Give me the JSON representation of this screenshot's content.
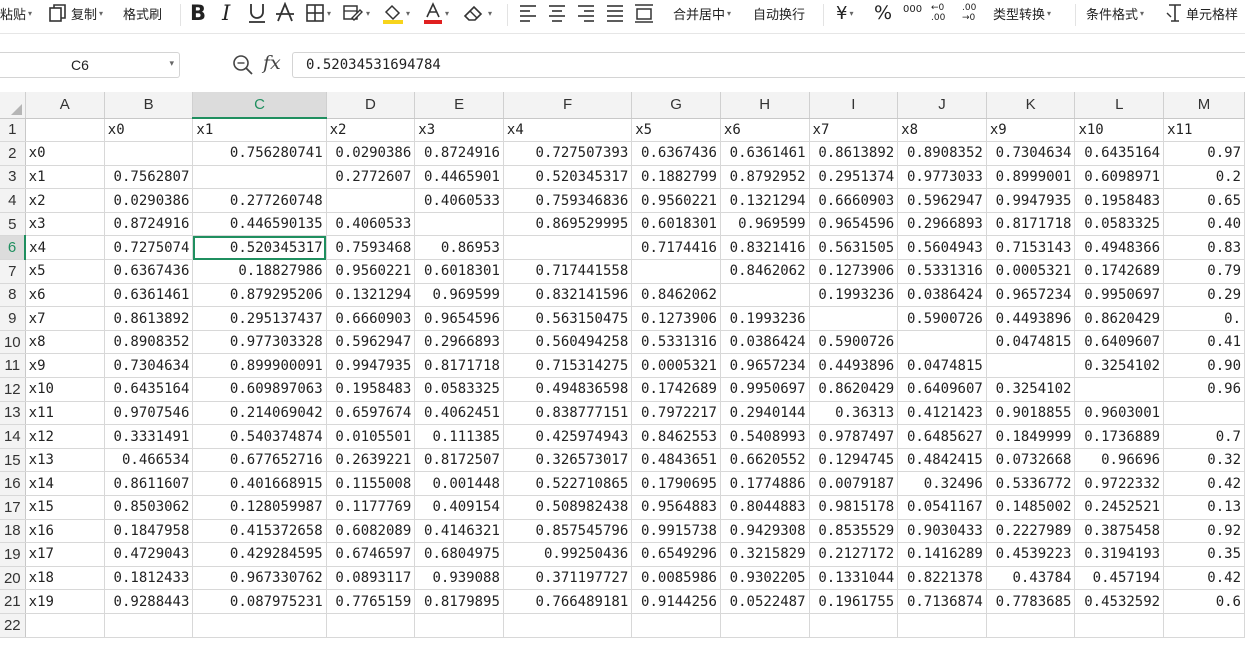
{
  "toolbar": {
    "paste": "粘贴",
    "copy": "复制",
    "format_painter": "格式刷",
    "merge_center": "合并居中",
    "wrap_text": "自动换行",
    "currency_symbol": "¥",
    "percent_symbol": "%",
    "thousands_symbol": "000",
    "increase_decimal": "←0 .00",
    "decrease_decimal": ".00 →0",
    "type_convert": "类型转换",
    "conditional_format": "条件格式",
    "cell_style": "单元格样",
    "font_color": "#e02020",
    "fill_color": "#f7d41c"
  },
  "formula_bar": {
    "name_box": "C6",
    "fx_label": "fx",
    "value": "0.52034531694784"
  },
  "grid": {
    "columns": [
      "A",
      "B",
      "C",
      "D",
      "E",
      "F",
      "G",
      "H",
      "I",
      "J",
      "K",
      "L",
      "M"
    ],
    "row_numbers": [
      "1",
      "2",
      "3",
      "4",
      "5",
      "6",
      "7",
      "8",
      "9",
      "10",
      "11",
      "12",
      "13",
      "14",
      "15",
      "16",
      "17",
      "18",
      "19",
      "20",
      "21",
      "22"
    ],
    "selected_column": "C",
    "selected_row": "6",
    "active_cell": "C6",
    "accent_color": "#1f8f5f",
    "rows": [
      [
        "",
        "x0",
        "x1",
        "x2",
        "x3",
        "x4",
        "x5",
        "x6",
        "x7",
        "x8",
        "x9",
        "x10",
        "x11"
      ],
      [
        "x0",
        "",
        "0.756280741",
        "0.0290386",
        "0.8724916",
        "0.727507393",
        "0.6367436",
        "0.6361461",
        "0.8613892",
        "0.8908352",
        "0.7304634",
        "0.6435164",
        "0.97"
      ],
      [
        "x1",
        "0.7562807",
        "",
        "0.2772607",
        "0.4465901",
        "0.520345317",
        "0.1882799",
        "0.8792952",
        "0.2951374",
        "0.9773033",
        "0.8999001",
        "0.6098971",
        "0.2"
      ],
      [
        "x2",
        "0.0290386",
        "0.27726074​8",
        "",
        "0.4060533",
        "0.759346836",
        "0.9560221",
        "0.1321294",
        "0.6660903",
        "0.5962947",
        "0.9947935",
        "0.1958483",
        "0.65"
      ],
      [
        "x3",
        "0.8724916",
        "0.446590135",
        "0.4060533",
        "",
        "0.869529995",
        "0.6018301",
        "0.969599",
        "0.9654596",
        "0.2966893",
        "0.8171718",
        "0.0583325",
        "0.40"
      ],
      [
        "x4",
        "0.7275074",
        "0.520345317",
        "0.7593468",
        "0.86953",
        "",
        "0.7174416",
        "0.8321416",
        "0.5631505",
        "0.5604943",
        "0.7153143",
        "0.4948366",
        "0.83"
      ],
      [
        "x5",
        "0.6367436",
        "0.18827986",
        "0.9560221",
        "0.6018301",
        "0.717441558",
        "",
        "0.8462062",
        "0.1273906",
        "0.5331316",
        "0.0005321",
        "0.1742689",
        "0.79"
      ],
      [
        "x6",
        "0.6361461",
        "0.879295206",
        "0.1321294",
        "0.969599",
        "0.832141596",
        "0.8462062",
        "",
        "0.1993236",
        "0.0386424",
        "0.9657234",
        "0.9950697",
        "0.29"
      ],
      [
        "x7",
        "0.8613892",
        "0.295137437",
        "0.6660903",
        "0.9654596",
        "0.563150475",
        "0.1273906",
        "0.1993236",
        "",
        "0.5900726",
        "0.4493896",
        "0.8620429",
        "0."
      ],
      [
        "x8",
        "0.8908352",
        "0.977303328",
        "0.5962947",
        "0.2966893",
        "0.560494258",
        "0.5331316",
        "0.0386424",
        "0.5900726",
        "",
        "0.0474815",
        "0.6409607",
        "0.41"
      ],
      [
        "x9",
        "0.7304634",
        "0.899900091",
        "0.9947935",
        "0.8171718",
        "0.715314275",
        "0.0005321",
        "0.9657234",
        "0.4493896",
        "0.0474815",
        "",
        "0.3254102",
        "0.90"
      ],
      [
        "x10",
        "0.6435164",
        "0.609897063",
        "0.1958483",
        "0.0583325",
        "0.494836598",
        "0.1742689",
        "0.9950697",
        "0.8620429",
        "0.6409607",
        "0.3254102",
        "",
        "0.96"
      ],
      [
        "x11",
        "0.9707546",
        "0.214069042",
        "0.6597674",
        "0.4062451",
        "0.838777151",
        "0.7972217",
        "0.2940144",
        "0.36313",
        "0.4121423",
        "0.9018855",
        "0.9603001",
        ""
      ],
      [
        "x12",
        "0.3331491",
        "0.540374874",
        "0.0105501",
        "0.111385",
        "0.425974943",
        "0.8462553",
        "0.5408993",
        "0.9787497",
        "0.6485627",
        "0.1849999",
        "0.1736889",
        "0.7"
      ],
      [
        "x13",
        "0.466534",
        "0.677652716",
        "0.2639221",
        "0.8172507",
        "0.326573017",
        "0.4843651",
        "0.6620552",
        "0.1294745",
        "0.4842415",
        "0.0732668",
        "0.96696",
        "0.32"
      ],
      [
        "x14",
        "0.8611607",
        "0.401668915",
        "0.1155008",
        "0.001448",
        "0.522710865",
        "0.1790695",
        "0.1774886",
        "0.0079187",
        "0.32496",
        "0.5336772",
        "0.9722332",
        "0.42"
      ],
      [
        "x15",
        "0.8503062",
        "0.128059987",
        "0.1177769",
        "0.409154",
        "0.508982438",
        "0.9564883",
        "0.8044883",
        "0.9815178",
        "0.0541167",
        "0.1485002",
        "0.2452521",
        "0.13"
      ],
      [
        "x16",
        "0.1847958",
        "0.415372658",
        "0.6082089",
        "0.4146321",
        "0.857545796",
        "0.9915738",
        "0.9429308",
        "0.8535529",
        "0.9030433",
        "0.2227989",
        "0.3875458",
        "0.92"
      ],
      [
        "x17",
        "0.4729043",
        "0.429284595",
        "0.6746597",
        "0.6804975",
        "0.99250436",
        "0.6549296",
        "0.3215829",
        "0.2127172",
        "0.1416289",
        "0.4539223",
        "0.3194193",
        "0.35"
      ],
      [
        "x18",
        "0.1812433",
        "0.967330762",
        "0.0893117",
        "0.939088",
        "0.371197727",
        "0.0085986",
        "0.9302205",
        "0.1331044",
        "0.8221378",
        "0.43784",
        "0.457194",
        "0.42"
      ],
      [
        "x19",
        "0.9288443",
        "0.087975231",
        "0.7765159",
        "0.8179895",
        "0.766489181",
        "0.9144256",
        "0.0522487",
        "0.1961755",
        "0.7136874",
        "0.7783685",
        "0.4532592",
        "0.6"
      ],
      [
        "",
        "",
        "",
        "",
        "",
        "",
        "",
        "",
        "",
        "",
        "",
        "",
        ""
      ]
    ]
  }
}
